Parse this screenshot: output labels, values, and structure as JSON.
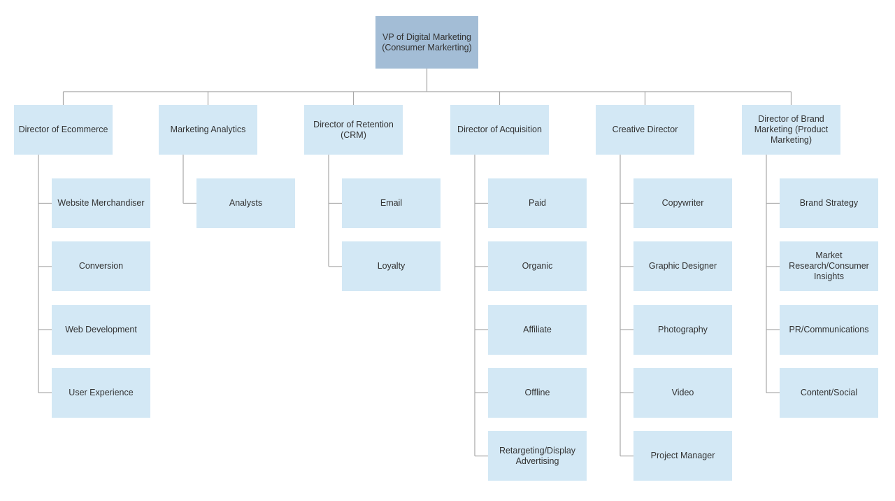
{
  "colors": {
    "root_fill": "#a3bdd6",
    "node_fill": "#d3e8f5",
    "connector": "#a8a8a8",
    "text": "#333333"
  },
  "root": {
    "label": "VP of Digital Marketing (Consumer Markerting)"
  },
  "departments": [
    {
      "label": "Director of Ecommerce",
      "children": [
        "Website Merchandiser",
        "Conversion",
        "Web Development",
        "User Experience"
      ]
    },
    {
      "label": "Marketing Analytics",
      "children": [
        "Analysts"
      ]
    },
    {
      "label": "Director of Retention (CRM)",
      "children": [
        "Email",
        "Loyalty"
      ]
    },
    {
      "label": "Director of Acquisition",
      "children": [
        "Paid",
        "Organic",
        "Affiliate",
        "Offline",
        "Retargeting/Display Advertising"
      ]
    },
    {
      "label": "Creative Director",
      "children": [
        "Copywriter",
        "Graphic Designer",
        "Photography",
        "Video",
        "Project Manager"
      ]
    },
    {
      "label": "Director of Brand Marketing (Product Marketing)",
      "children": [
        "Brand Strategy",
        "Market Research/Consumer Insights",
        "PR/Communications",
        "Content/Social"
      ]
    }
  ]
}
